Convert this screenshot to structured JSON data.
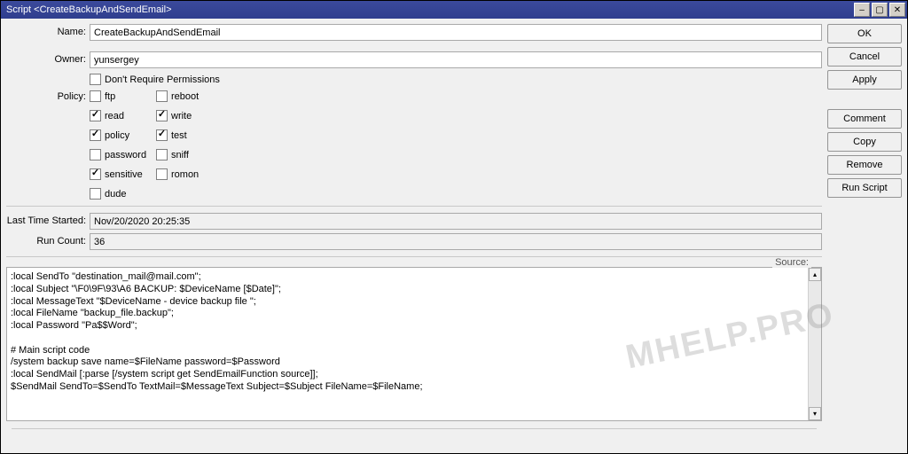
{
  "title": "Script <CreateBackupAndSendEmail>",
  "titlebar_btns": {
    "min": "–",
    "max": "▢",
    "close": "✕"
  },
  "buttons": {
    "ok": "OK",
    "cancel": "Cancel",
    "apply": "Apply",
    "comment": "Comment",
    "copy": "Copy",
    "remove": "Remove",
    "run": "Run Script"
  },
  "labels": {
    "name": "Name:",
    "owner": "Owner:",
    "policy": "Policy:",
    "last_started": "Last Time Started:",
    "run_count": "Run Count:",
    "source": "Source:"
  },
  "fields": {
    "name": "CreateBackupAndSendEmail",
    "owner": "yunsergey",
    "dont_require": "Don't Require Permissions",
    "last_started": "Nov/20/2020 20:25:35",
    "run_count": "36"
  },
  "policy": {
    "ftp": {
      "label": "ftp",
      "checked": false
    },
    "reboot": {
      "label": "reboot",
      "checked": false
    },
    "read": {
      "label": "read",
      "checked": true
    },
    "write": {
      "label": "write",
      "checked": true
    },
    "policy": {
      "label": "policy",
      "checked": true
    },
    "test": {
      "label": "test",
      "checked": true
    },
    "password": {
      "label": "password",
      "checked": false
    },
    "sniff": {
      "label": "sniff",
      "checked": false
    },
    "sensitive": {
      "label": "sensitive",
      "checked": true
    },
    "romon": {
      "label": "romon",
      "checked": false
    },
    "dude": {
      "label": "dude",
      "checked": false
    }
  },
  "source": ":local SendTo \"destination_mail@mail.com\";\n:local Subject \"\\F0\\9F\\93\\A6 BACKUP: $DeviceName [$Date]\";\n:local MessageText \"$DeviceName - device backup file \";\n:local FileName \"backup_file.backup\";\n:local Password \"Pa$$Word\";\n\n# Main script code\n/system backup save name=$FileName password=$Password\n:local SendMail [:parse [/system script get SendEmailFunction source]];\n$SendMail SendTo=$SendTo TextMail=$MessageText Subject=$Subject FileName=$FileName;",
  "watermark": "МHELP.PRO"
}
